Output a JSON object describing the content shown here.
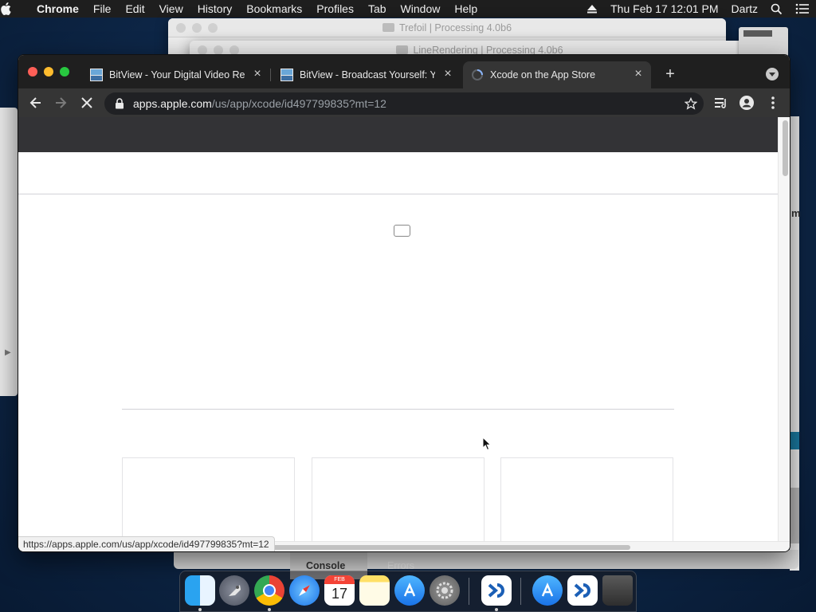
{
  "menubar": {
    "app_name": "Chrome",
    "items": [
      "File",
      "Edit",
      "View",
      "History",
      "Bookmarks",
      "Profiles",
      "Tab",
      "Window",
      "Help"
    ],
    "datetime": "Thu Feb 17  12:01 PM",
    "user": "Dartz"
  },
  "background_windows": {
    "window1_title": "Trefoil | Processing 4.0b6",
    "window2_title": "LineRendering | Processing 4.0b6",
    "console_tab": "Console",
    "errors_tab": "Errors",
    "right_edge_char": "m"
  },
  "browser": {
    "tabs": [
      {
        "title": "BitView - Your Digital Video Re",
        "favicon": "bitview-icon",
        "active": false
      },
      {
        "title": "BitView - Broadcast Yourself: Y",
        "favicon": "bitview-icon",
        "active": false
      },
      {
        "title": "Xcode on the App Store",
        "favicon": "loading-spinner-icon",
        "active": true
      }
    ],
    "address": {
      "host": "apps.apple.com",
      "path": "/us/app/xcode/id497799835?mt=12"
    },
    "status_url": "https://apps.apple.com/us/app/xcode/id497799835?mt=12",
    "loading": true
  },
  "dock": {
    "apps": [
      "Finder",
      "Launchpad",
      "Google Chrome",
      "Safari",
      "Calendar",
      "Notes",
      "App Store",
      "System Preferences",
      "Processing",
      "App Store",
      "Processing",
      "Trash"
    ],
    "calendar_month": "FEB",
    "calendar_day": "17"
  },
  "colors": {
    "chrome_tabstrip": "#1f1f1f",
    "chrome_toolbar": "#353535",
    "apple_globalnav": "#333336",
    "accent_blue": "#8ab4f8"
  }
}
